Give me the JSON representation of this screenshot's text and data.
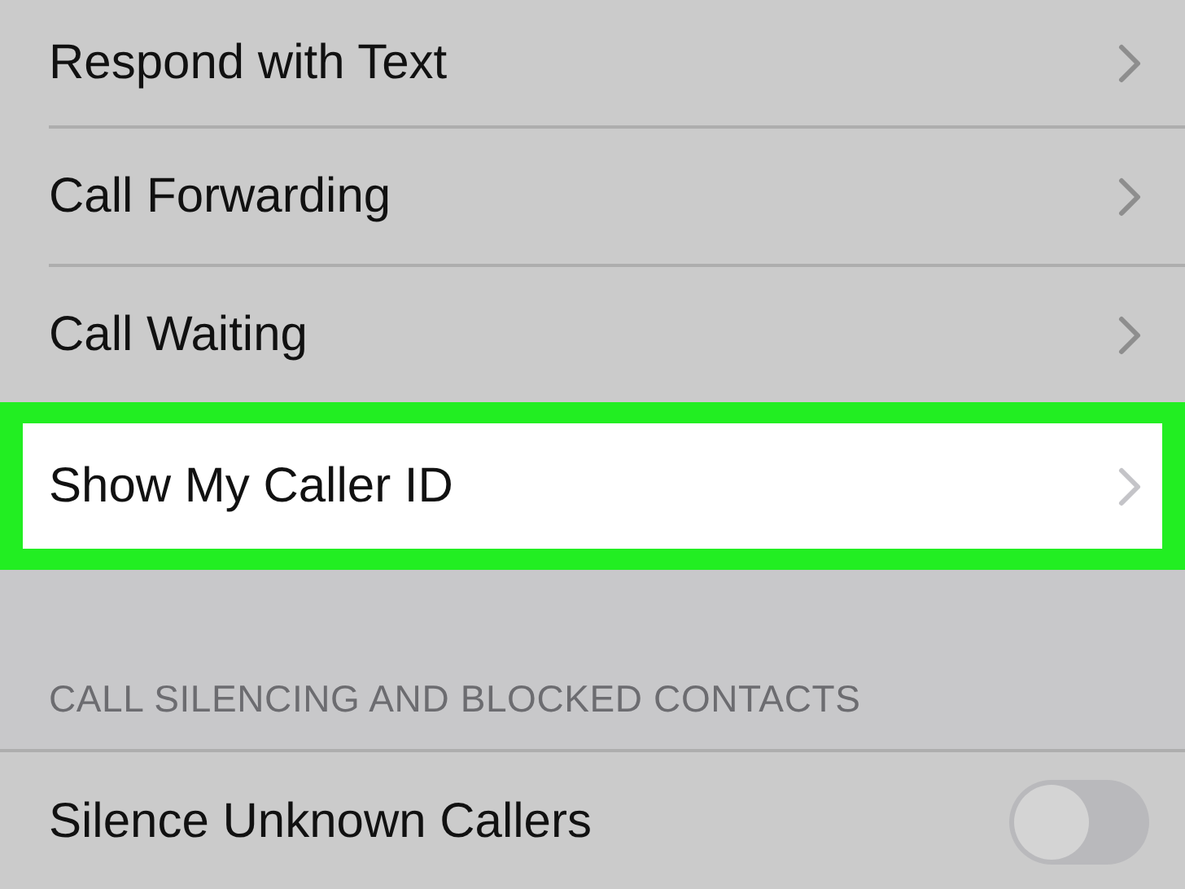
{
  "rows": [
    {
      "label": "Respond with Text",
      "highlighted": false
    },
    {
      "label": "Call Forwarding",
      "highlighted": false
    },
    {
      "label": "Call Waiting",
      "highlighted": false
    },
    {
      "label": "Show My Caller ID",
      "highlighted": true
    }
  ],
  "section": {
    "header": "CALL SILENCING AND BLOCKED CONTACTS",
    "rows": [
      {
        "label": "Silence Unknown Callers",
        "on": false
      }
    ]
  }
}
